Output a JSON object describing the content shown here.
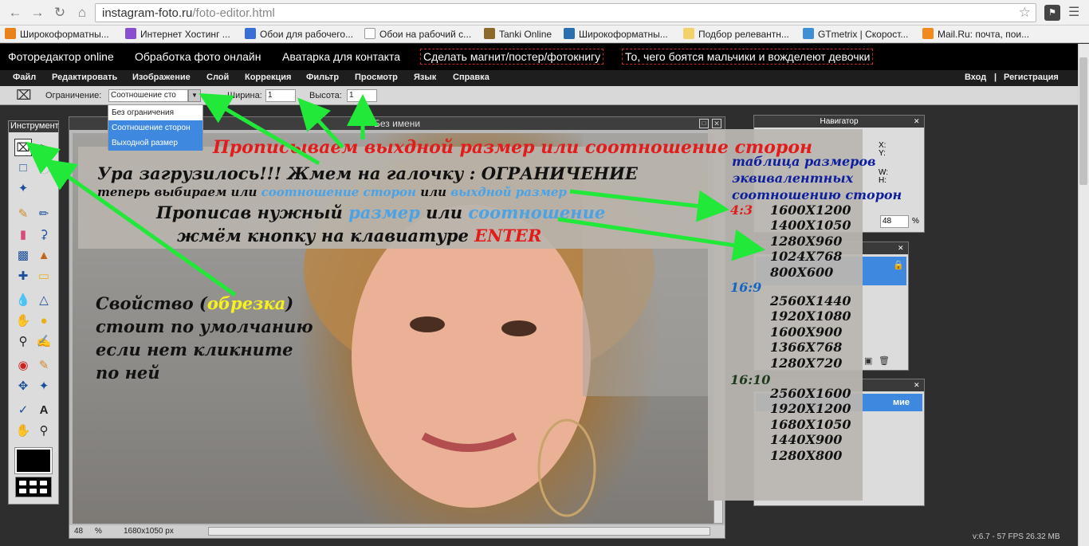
{
  "browser": {
    "url_host": "instagram-foto.ru",
    "url_path": "/foto-editor.html"
  },
  "bookmarks": [
    {
      "label": "Широкоформатны...",
      "icon": "w-orange-icon",
      "color": "#e8831c"
    },
    {
      "label": "Интернет Хостинг ...",
      "icon": "colored-squares-icon",
      "color": "#8a4fd1"
    },
    {
      "label": "Обои для рабочего...",
      "icon": "globe-icon",
      "color": "#3b6fd8"
    },
    {
      "label": "Обои на рабочий с...",
      "icon": "page-icon",
      "color": "#ffffff"
    },
    {
      "label": "Tanki Online",
      "icon": "tank-icon",
      "color": "#8b6a2c"
    },
    {
      "label": "Широкоформатны...",
      "icon": "s-icon",
      "color": "#2a6fb0"
    },
    {
      "label": "Подбор релевантн...",
      "icon": "a-icon",
      "color": "#f3d26b"
    },
    {
      "label": "GTmetrix | Скорост...",
      "icon": "gtmetrix-icon",
      "color": "#3f8fd6"
    },
    {
      "label": "Mail.Ru: почта, пои...",
      "icon": "at-icon",
      "color": "#f08a1d"
    }
  ],
  "site_nav": [
    "Фоторедактор online",
    "Обработка фото онлайн",
    "Аватарка для контакта",
    "Сделать магнит/постер/фотокнигу",
    "То, чего боятся мальчики и вожделеют девочки"
  ],
  "menu": {
    "items": [
      "Файл",
      "Редактировать",
      "Изображение",
      "Слой",
      "Коррекция",
      "Фильтр",
      "Просмотр",
      "Язык",
      "Справка"
    ],
    "login": "Вход",
    "sep": "|",
    "register": "Регистрация"
  },
  "options": {
    "constraint_label": "Ограничение:",
    "constraint_value": "Соотношение сто",
    "width_label": "Ширина:",
    "width_value": "1",
    "height_label": "Высота:",
    "height_value": "1"
  },
  "dropdown": [
    {
      "label": "Без ограничения",
      "selected": false
    },
    {
      "label": "Соотношение сторон",
      "selected": true
    },
    {
      "label": "Выходной размер",
      "selected": true
    }
  ],
  "tools_title": "Инструмент",
  "canvas": {
    "title": "Без имени",
    "zoom": "48",
    "zoom_unit": "%",
    "size": "1680x1050 px"
  },
  "navigator": {
    "title": "Навигатор",
    "x": "X:",
    "y": "Y:",
    "w": "W:",
    "h": "H:",
    "zoom": "48",
    "zoom_unit": "%"
  },
  "history_panel_text": "мие",
  "annotations": {
    "headline": "Прописываем выхдной размер или соотношение сторон",
    "line1": "Ура загрузилось!!! Жмем на галочку : ОГРАНИЧЕНИЕ",
    "line2a": "теперь выбираем или ",
    "line2b": "соотношение сторон",
    "line2c": " или ",
    "line2d": "выхдной размер",
    "line3a": "Прописав нужный ",
    "line3b": "размер",
    "line3c": " или ",
    "line3d": "соотношение",
    "line4a": "жмём кнопку на клавиатуре ",
    "line4b": "ENTER",
    "prop1a": "Свойство (",
    "prop1b": "обрезка",
    "prop1c": ")",
    "prop2": "стоит по умолчанию",
    "prop3": "если нет кликните",
    "prop4": "по ней"
  },
  "sizes_table": {
    "heading": [
      "таблица размеров",
      "эквивалентных",
      "соотношению сторон"
    ],
    "groups": [
      {
        "ratio": "4:3",
        "color": "#e31b1b",
        "sizes": [
          "1600X1200",
          "1400X1050",
          "1280X960",
          "1024X768",
          "800X600"
        ]
      },
      {
        "ratio": "16:9",
        "color": "#1565c0",
        "sizes": [
          "2560X1440",
          "1920X1080",
          "1600X900",
          "1366X768",
          "1280X720"
        ]
      },
      {
        "ratio": "16:10",
        "color": "#1e3a1e",
        "sizes": [
          "2560X1600",
          "1920X1200",
          "1680X1050",
          "1440X900",
          "1280X800"
        ]
      }
    ]
  },
  "colors": {
    "headline": "#e31b1b",
    "highlight_blue": "#4aa3e6",
    "highlight_yellow": "#f7f21b",
    "arrow": "#22e83a",
    "enter": "#e31b1b"
  },
  "fps_text": "v:6.7 - 57 FPS 26.32 MB"
}
